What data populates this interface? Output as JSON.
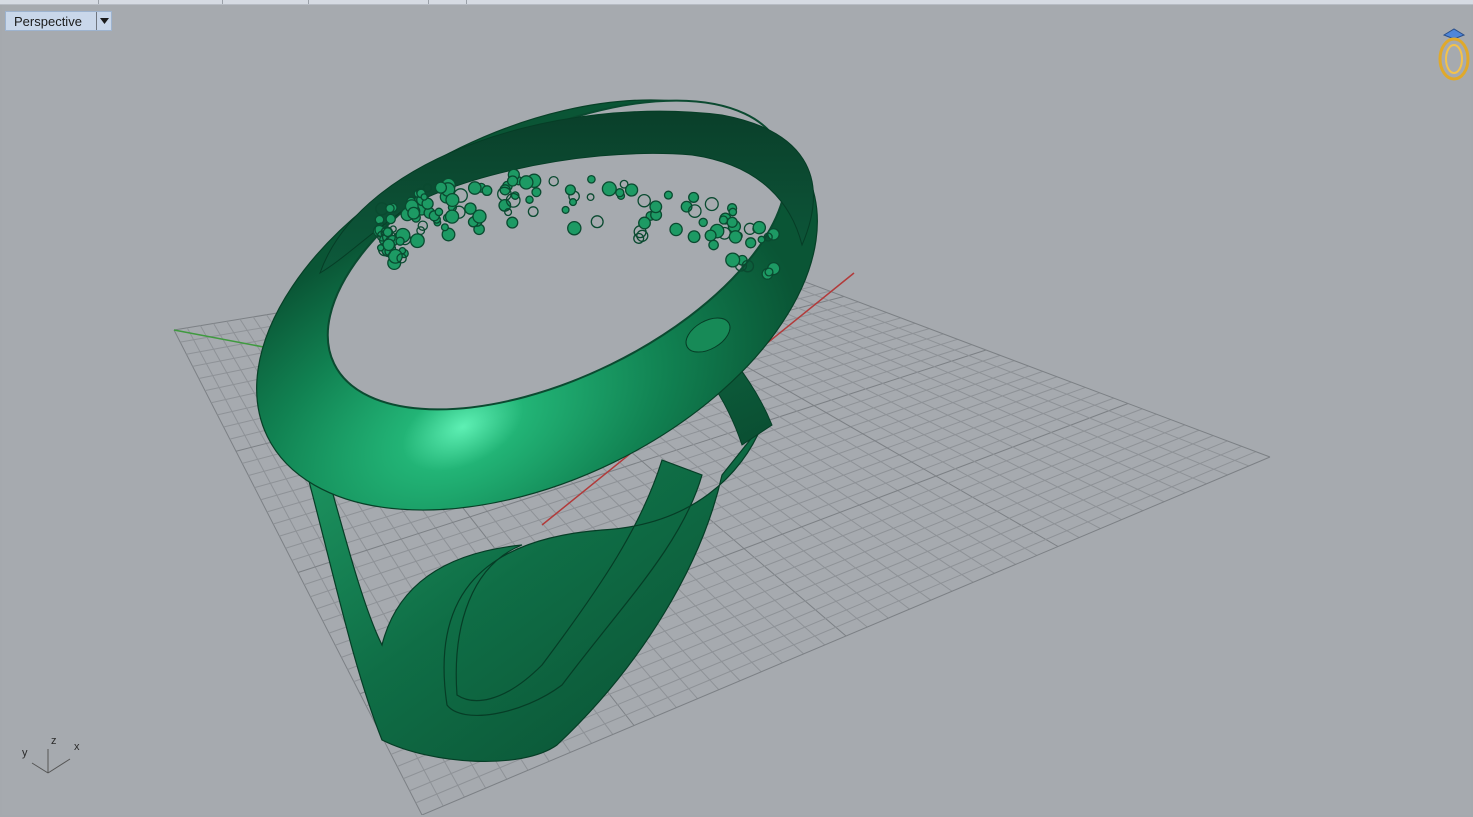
{
  "viewport": {
    "title": "Perspective",
    "menu_icon": "dropdown-arrow-icon",
    "display_mode": "shaded",
    "object": "ring-model",
    "object_color": "#1a8a5c",
    "grid_color": "#8c9095",
    "axis_colors": {
      "x": "#b23a3a",
      "y": "#3f9a3f"
    }
  },
  "axis_widget": {
    "z": "z",
    "x": "x",
    "y": "y"
  },
  "corner_icon": "ring-thumbnail-icon"
}
